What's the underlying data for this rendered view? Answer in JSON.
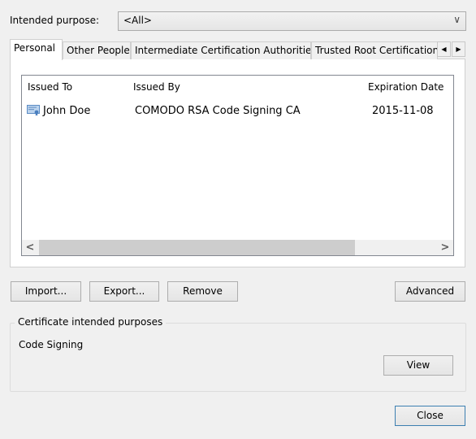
{
  "purpose": {
    "label": "Intended purpose:",
    "selected": "<All>",
    "chevron_icon": "chevron-down-icon"
  },
  "tabs": [
    {
      "label": "Personal",
      "active": true
    },
    {
      "label": "Other People",
      "active": false
    },
    {
      "label": "Intermediate Certification Authorities",
      "active": false
    },
    {
      "label": "Trusted Root Certification",
      "active": false
    }
  ],
  "tab_scroll": {
    "left": "◀",
    "right": "▶"
  },
  "list": {
    "columns": [
      "Issued To",
      "Issued By",
      "Expiration Date"
    ],
    "rows": [
      {
        "issued_to": "John Doe",
        "issued_by": "COMODO RSA Code Signing CA",
        "expiration": "2015-11-08",
        "icon": "certificate-icon"
      }
    ],
    "scroll_left": "<",
    "scroll_right": ">"
  },
  "buttons": {
    "import": "Import...",
    "export": "Export...",
    "remove": "Remove",
    "advanced": "Advanced",
    "view": "View",
    "close": "Close"
  },
  "purposes_group": {
    "title": "Certificate intended purposes",
    "value": "Code Signing"
  }
}
